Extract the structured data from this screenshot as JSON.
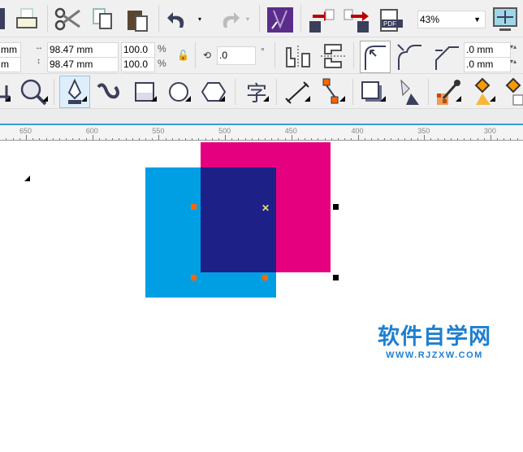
{
  "toolbar": {
    "zoom_value": "43%",
    "undo": "undo",
    "redo": "redo"
  },
  "property_bar": {
    "x_suffix": "mm",
    "y_suffix": "m",
    "width": "98.47 mm",
    "height": "98.47 mm",
    "scale_x": "100.0",
    "scale_y": "100.0",
    "percent": "%",
    "rotation": ".0",
    "degree": "°",
    "corner_1": ".0 mm",
    "corner_2": ".0 mm"
  },
  "toolbox": {
    "text_tool_glyph": "字"
  },
  "ruler": {
    "ticks": [
      "650",
      "600",
      "550",
      "500",
      "450",
      "400",
      "350",
      "300"
    ]
  },
  "canvas": {
    "colors": {
      "magenta": "#e4007f",
      "cyan": "#009fe3",
      "overlap": "#1d2087"
    }
  },
  "watermark": {
    "title": "软件自学网",
    "url": "WWW.RJZXW.COM"
  }
}
